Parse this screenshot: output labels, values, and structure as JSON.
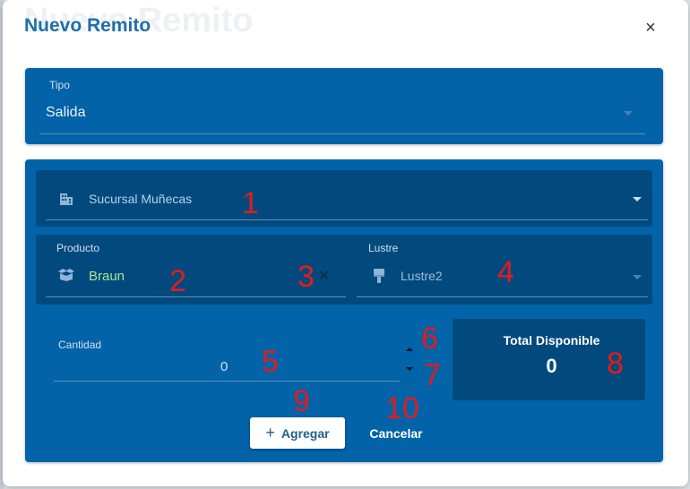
{
  "dialog": {
    "ghost_title": "Nuevo Remito",
    "title": "Nuevo Remito",
    "close_symbol": "×"
  },
  "tipo": {
    "label": "Tipo",
    "value": "Salida"
  },
  "sucursal": {
    "value": "Sucursal Muñecas",
    "icon": "building-icon"
  },
  "producto": {
    "label": "Producto",
    "value": "Braun",
    "icon": "box-icon",
    "clear_symbol": "✕"
  },
  "lustre": {
    "label": "Lustre",
    "value": "Lustre2",
    "icon": "brush-icon"
  },
  "cantidad": {
    "label": "Cantidad",
    "value": "0"
  },
  "total": {
    "label": "Total Disponible",
    "value": "0"
  },
  "actions": {
    "add_label": "Agregar",
    "add_symbol": "+",
    "cancel_label": "Cancelar"
  },
  "annotations": [
    "1",
    "2",
    "3",
    "4",
    "5",
    "6",
    "7",
    "8",
    "9",
    "10"
  ],
  "colors": {
    "panel": "#0263a8",
    "subpanel": "#024a7e",
    "title": "#1f6fa8",
    "annotation": "#e31b1b",
    "product_value": "#a9e58f"
  }
}
